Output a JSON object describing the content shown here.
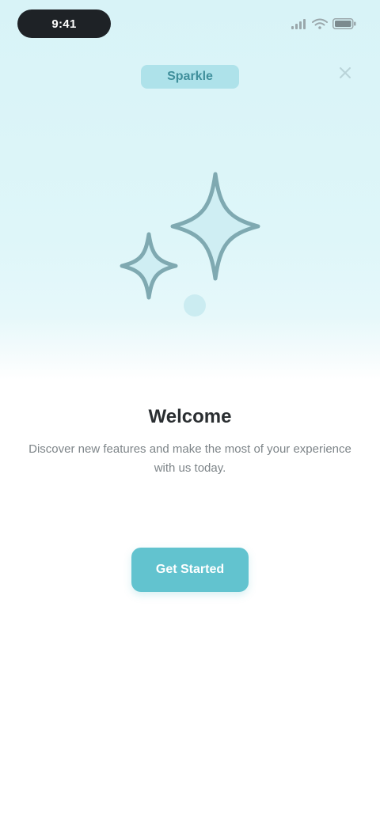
{
  "status_bar": {
    "time": "9:41",
    "icons": [
      "signal-icon",
      "wifi-icon",
      "battery-icon"
    ]
  },
  "header": {
    "logo_text": "Sparkle",
    "close_icon": "close-icon"
  },
  "illustration": {
    "icon": "sparkles-icon"
  },
  "content": {
    "title": "Welcome",
    "description": "Discover new features and make the most of your experience with us today."
  },
  "cta": {
    "label": "Get Started"
  },
  "colors": {
    "accent": "#62c3cf",
    "hero_background": "#daf4f8",
    "title": "#2a2e31",
    "body": "#7e8589"
  }
}
